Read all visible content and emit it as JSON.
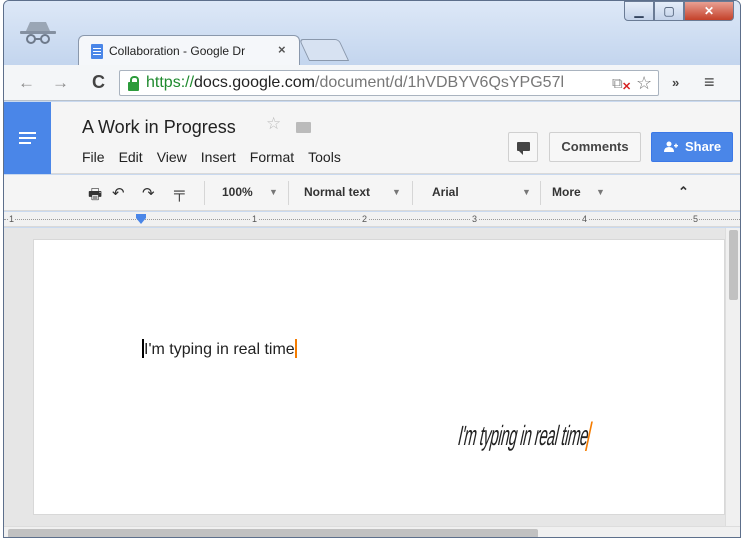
{
  "browser": {
    "tab_title": "Collaboration - Google Dr",
    "tab_close": "×",
    "url_scheme": "https://",
    "url_host": "docs.google.com",
    "url_path": "/document/d/1hVDBYV6QsYPG57l",
    "back": "←",
    "forward": "→",
    "reload": "C",
    "bookmark_star": "☆",
    "overflow": "»",
    "menu": "≡",
    "window_buttons": {
      "minimize": "▁",
      "maximize": "▢",
      "close": "✕"
    }
  },
  "docs": {
    "title": "A Work in Progress",
    "star": "☆",
    "menus": [
      "File",
      "Edit",
      "View",
      "Insert",
      "Format",
      "Tools"
    ],
    "comments_label": "Comments",
    "share_label": "Share",
    "format": {
      "zoom": "100%",
      "style": "Normal text",
      "font": "Arial",
      "more": "More",
      "collapse": "≈"
    },
    "ruler_numbers": [
      "1",
      "1",
      "2",
      "3",
      "4",
      "5"
    ],
    "page_text": "I'm typing in real time",
    "animated_text": "I'm typing in real time"
  },
  "colors": {
    "accent": "#4a86e8",
    "cursor": "#f57c00",
    "secure": "#1f8a2e"
  }
}
